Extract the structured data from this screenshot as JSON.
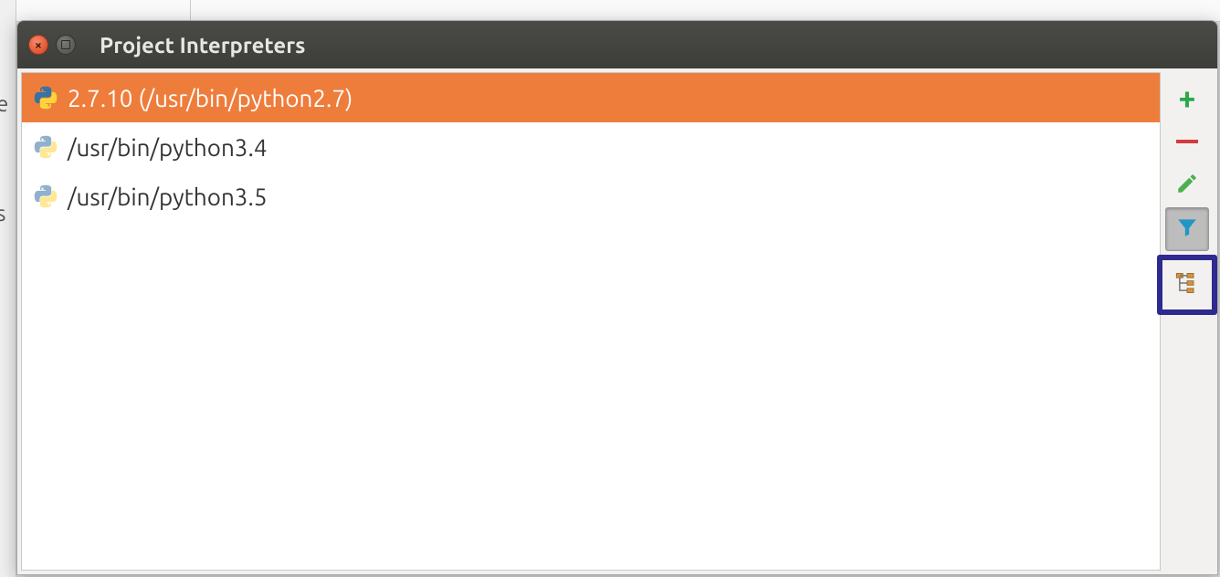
{
  "window": {
    "title": "Project Interpreters"
  },
  "interpreters": [
    {
      "label": "2.7.10 (/usr/bin/python2.7)",
      "selected": true,
      "faded": false
    },
    {
      "label": "/usr/bin/python3.4",
      "selected": false,
      "faded": true
    },
    {
      "label": "/usr/bin/python3.5",
      "selected": false,
      "faded": true
    }
  ],
  "toolbar": {
    "add": "add",
    "remove": "remove",
    "edit": "edit",
    "filter": "filter",
    "paths": "paths"
  },
  "backdrop": {
    "stub1": "e",
    "stub2": "s"
  }
}
